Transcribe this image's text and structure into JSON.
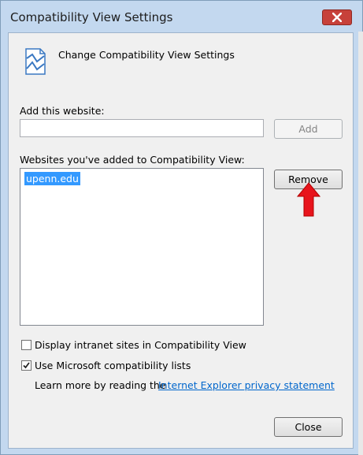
{
  "window": {
    "title": "Compatibility View Settings",
    "close_icon": "close-icon"
  },
  "header": {
    "title": "Change Compatibility View Settings",
    "icon": "compatibility-view-icon"
  },
  "add_website": {
    "label": "Add this website:",
    "value": "",
    "placeholder": "",
    "add_button": "Add"
  },
  "sites_list": {
    "label": "Websites you've added to Compatibility View:",
    "items": [
      "upenn.edu"
    ],
    "remove_button": "Remove"
  },
  "options": {
    "intranet": {
      "label": "Display intranet sites in Compatibility View",
      "checked": false
    },
    "ms_lists": {
      "label": "Use Microsoft compatibility lists",
      "checked": true
    }
  },
  "learn_more": {
    "text": "Learn more by reading the",
    "link": "Internet Explorer privacy statement"
  },
  "footer": {
    "close_button": "Close"
  },
  "colors": {
    "accent": "#3399ff",
    "annotation_arrow": "#e8141c",
    "link": "#0066cc"
  }
}
